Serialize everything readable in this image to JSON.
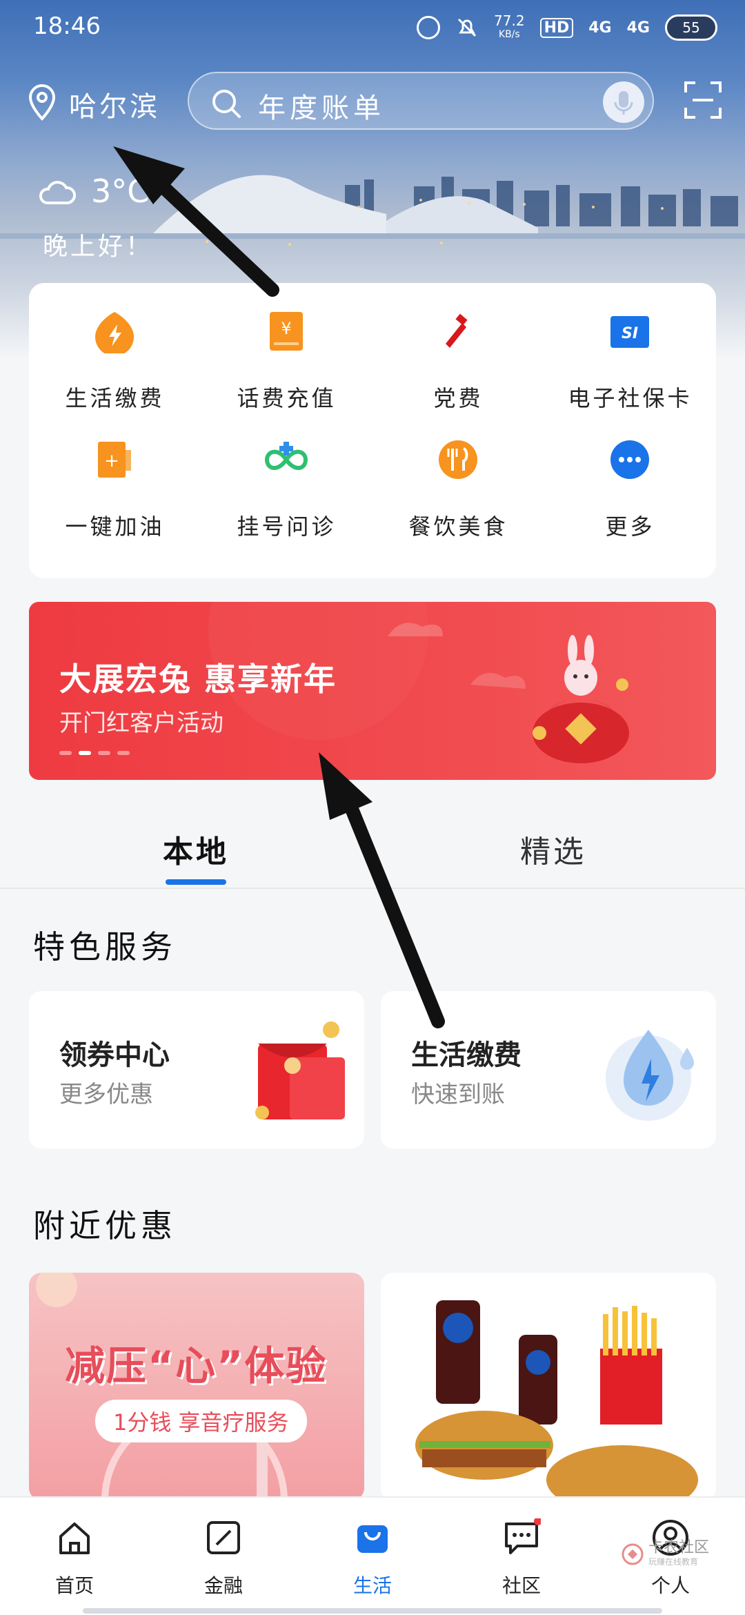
{
  "status_bar": {
    "time": "18:46",
    "net_speed": "77.2",
    "net_unit": "KB/s",
    "hd": "HD",
    "signal_1": "4G",
    "signal_2": "4G",
    "battery": "55"
  },
  "header": {
    "location": "哈尔滨",
    "search_placeholder": "年度账单"
  },
  "weather": {
    "temperature": "3°C",
    "greeting": "晚上好！"
  },
  "services": [
    {
      "label": "生活缴费",
      "icon": "lightning-icon",
      "color": "#f7931e"
    },
    {
      "label": "话费充值",
      "icon": "phone-bill-icon",
      "color": "#f7931e"
    },
    {
      "label": "党费",
      "icon": "party-emblem-icon",
      "color": "#d7191e"
    },
    {
      "label": "电子社保卡",
      "icon": "social-security-card-icon",
      "color": "#1a73e8"
    },
    {
      "label": "一键加油",
      "icon": "fuel-icon",
      "color": "#f7931e"
    },
    {
      "label": "挂号问诊",
      "icon": "medical-icon",
      "color": "#2fbf71"
    },
    {
      "label": "餐饮美食",
      "icon": "dining-icon",
      "color": "#f7931e"
    },
    {
      "label": "更多",
      "icon": "more-icon",
      "color": "#1a73e8"
    }
  ],
  "banner": {
    "title": "大展宏兔 惠享新年",
    "subtitle": "开门红客户活动",
    "slides": 4,
    "active_slide": 2
  },
  "tabs": {
    "local": "本地",
    "featured": "精选"
  },
  "featured_services": {
    "title": "特色服务",
    "cards": [
      {
        "title": "领券中心",
        "subtitle": "更多优惠"
      },
      {
        "title": "生活缴费",
        "subtitle": "快速到账"
      }
    ]
  },
  "nearby": {
    "title": "附近优惠",
    "promo_headline": "减压“心”体验",
    "promo_pill": "1分钱 享音疗服务"
  },
  "bottom_nav": [
    {
      "label": "首页",
      "icon": "home-icon"
    },
    {
      "label": "金融",
      "icon": "finance-icon"
    },
    {
      "label": "生活",
      "icon": "shopping-bag-icon",
      "active": true
    },
    {
      "label": "社区",
      "icon": "chat-icon"
    },
    {
      "label": "个人",
      "icon": "profile-icon"
    }
  ],
  "watermark": {
    "text": "卡农社区",
    "sub": "玩赚在线教育"
  },
  "colors": {
    "accent": "#1a73e8",
    "banner_red": "#ee3b41",
    "hero_blue": "#3f6fb7"
  }
}
